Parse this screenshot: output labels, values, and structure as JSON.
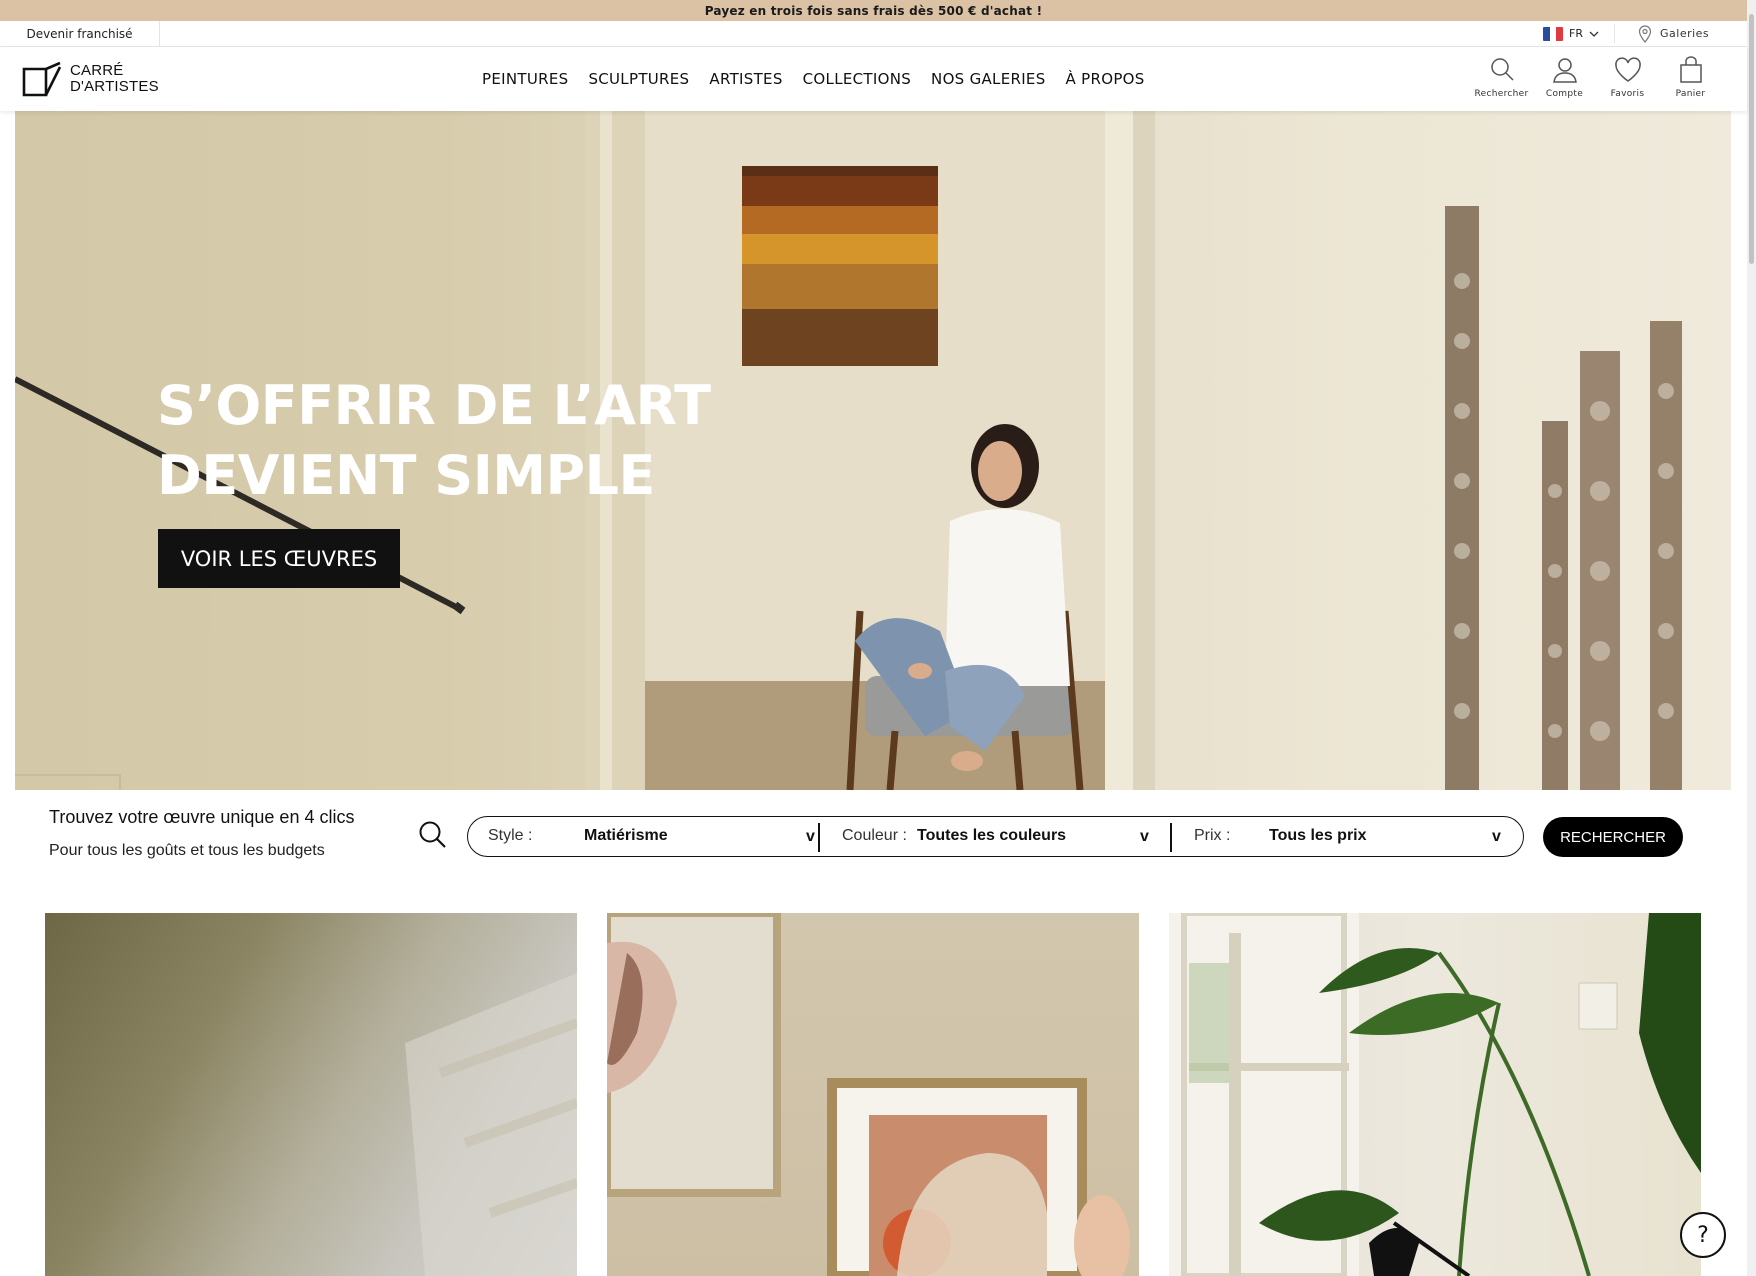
{
  "promo": {
    "text": "Payez en trois fois sans frais dès 500 € d'achat !"
  },
  "utility": {
    "franchise_link": "Devenir franchisé",
    "language": "FR",
    "galleries_link": "Galeries"
  },
  "logo": {
    "line1": "CARRÉ",
    "line2": "D'ARTISTES"
  },
  "nav": {
    "items": [
      "PEINTURES",
      "SCULPTURES",
      "ARTISTES",
      "COLLECTIONS",
      "NOS GALERIES",
      "À PROPOS"
    ]
  },
  "tools": {
    "search": "Rechercher",
    "account": "Compte",
    "favorites": "Favoris",
    "cart": "Panier"
  },
  "hero": {
    "title_line1": "S’OFFRIR DE L’ART",
    "title_line2": "DEVIENT SIMPLE",
    "cta": "VOIR LES ŒUVRES"
  },
  "finder": {
    "title": "Trouvez votre œuvre unique en 4 clics",
    "subtitle": "Pour tous les goûts et tous les budgets",
    "filters": [
      {
        "label": "Style :",
        "value": "Matiérisme"
      },
      {
        "label": "Couleur :",
        "value": "Toutes les couleurs"
      },
      {
        "label": "Prix :",
        "value": "Tous les prix"
      }
    ],
    "chevron": "v",
    "button": "RECHERCHER"
  },
  "help": {
    "label": "?"
  },
  "colors": {
    "promo_bg": "#dcc2a5",
    "primary": "#111111",
    "hero_text": "#ffffff"
  }
}
